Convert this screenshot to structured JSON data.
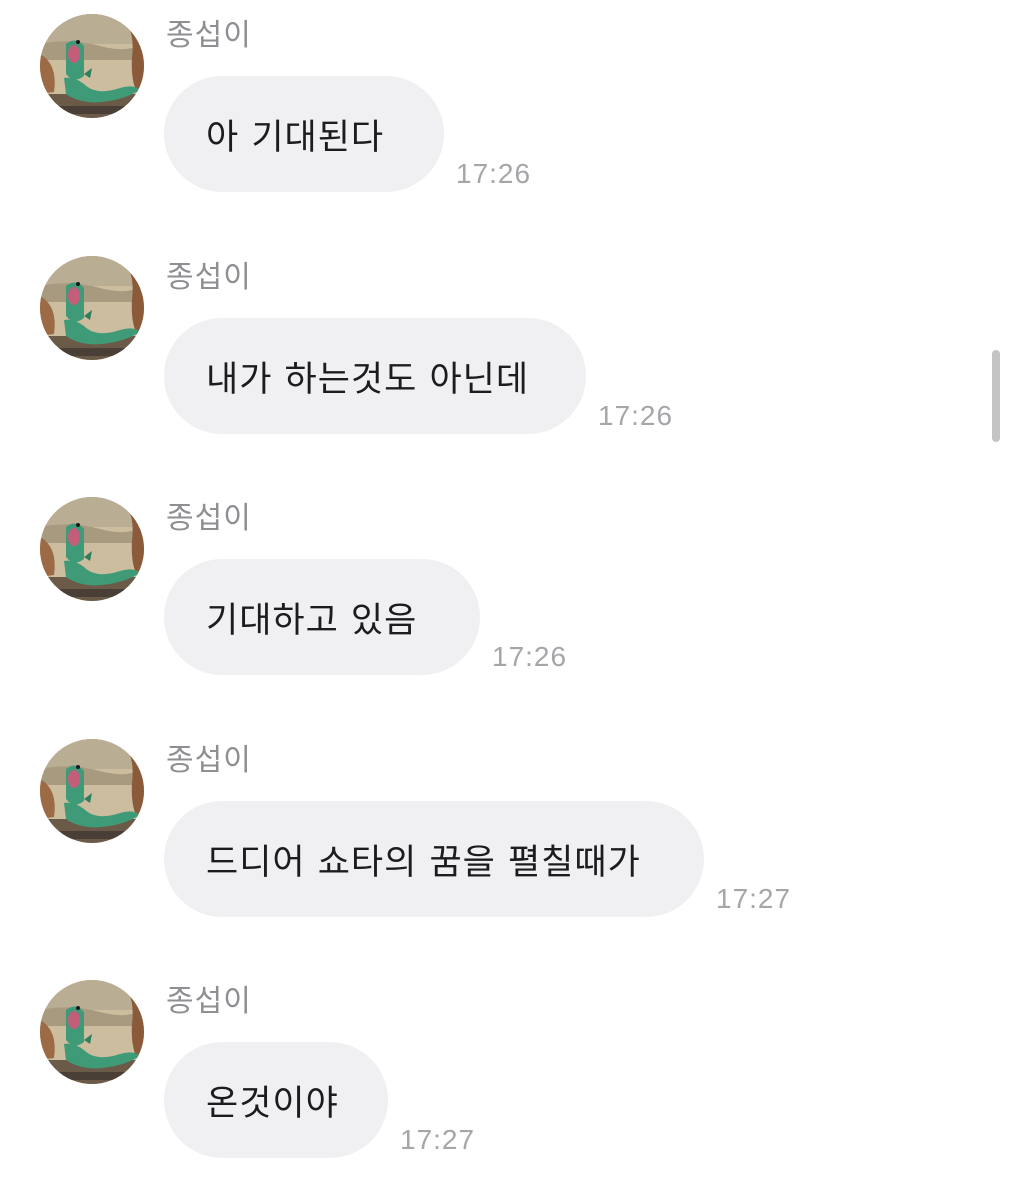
{
  "messages": [
    {
      "sender": "종섭이",
      "text": "아 기대된다",
      "time": "17:26",
      "avatar_icon": "dinosaur-avatar-icon"
    },
    {
      "sender": "종섭이",
      "text": "내가 하는것도 아닌데",
      "time": "17:26",
      "avatar_icon": "dinosaur-avatar-icon"
    },
    {
      "sender": "종섭이",
      "text": "기대하고 있음",
      "time": "17:26",
      "avatar_icon": "dinosaur-avatar-icon"
    },
    {
      "sender": "종섭이",
      "text": "드디어 쇼타의 꿈을 펼칠때가",
      "time": "17:27",
      "avatar_icon": "dinosaur-avatar-icon"
    },
    {
      "sender": "종섭이",
      "text": "온것이야",
      "time": "17:27",
      "avatar_icon": "dinosaur-avatar-icon"
    }
  ],
  "colors": {
    "background": "#ffffff",
    "bubble": "#f0f0f2",
    "message_text": "#1c1c1e",
    "sender_name": "#8e8e93",
    "timestamp": "#a6a6aa",
    "scrollbar": "#c4c4c7"
  }
}
